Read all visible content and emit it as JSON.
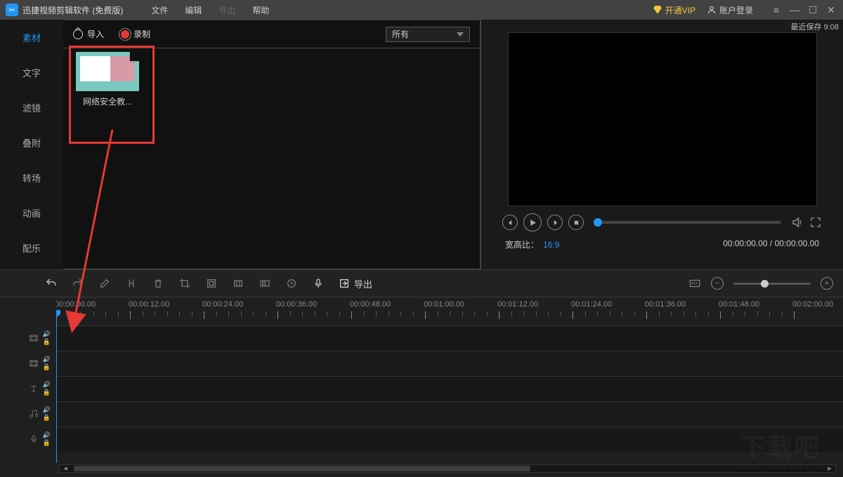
{
  "titlebar": {
    "app_title": "迅捷视频剪辑软件 (免费版)",
    "menu": {
      "file": "文件",
      "edit": "编辑",
      "export": "导出",
      "help": "帮助"
    },
    "vip_label": "开通VIP",
    "login_label": "账户登录"
  },
  "last_save": "最近保存 9:08",
  "left_tabs": {
    "items": [
      {
        "label": "素材"
      },
      {
        "label": "文字"
      },
      {
        "label": "滤镜"
      },
      {
        "label": "叠附"
      },
      {
        "label": "转场"
      },
      {
        "label": "动画"
      },
      {
        "label": "配乐"
      }
    ]
  },
  "media_toolbar": {
    "import_label": "导入",
    "record_label": "录制",
    "filter_label": "所有"
  },
  "media_item": {
    "label": "网络安全教..."
  },
  "preview": {
    "aspect_label": "宽高比：",
    "aspect_value": "16:9",
    "timecode": "00:00:00.00 / 00:00:00.00"
  },
  "toolbar": {
    "export_label": "导出"
  },
  "timeline": {
    "labels": [
      "00:00:00.00",
      "00:00:12.00",
      "00:00:24.00",
      "00:00:36.00",
      "00:00:48.00",
      "00:01:00.00",
      "00:01:12.00",
      "00:01:24.00",
      "00:01:36.00",
      "00:01:48.00",
      "00:02:00.00"
    ]
  },
  "watermark": {
    "big": "下载吧",
    "small": "www.xiazaiba.com"
  }
}
